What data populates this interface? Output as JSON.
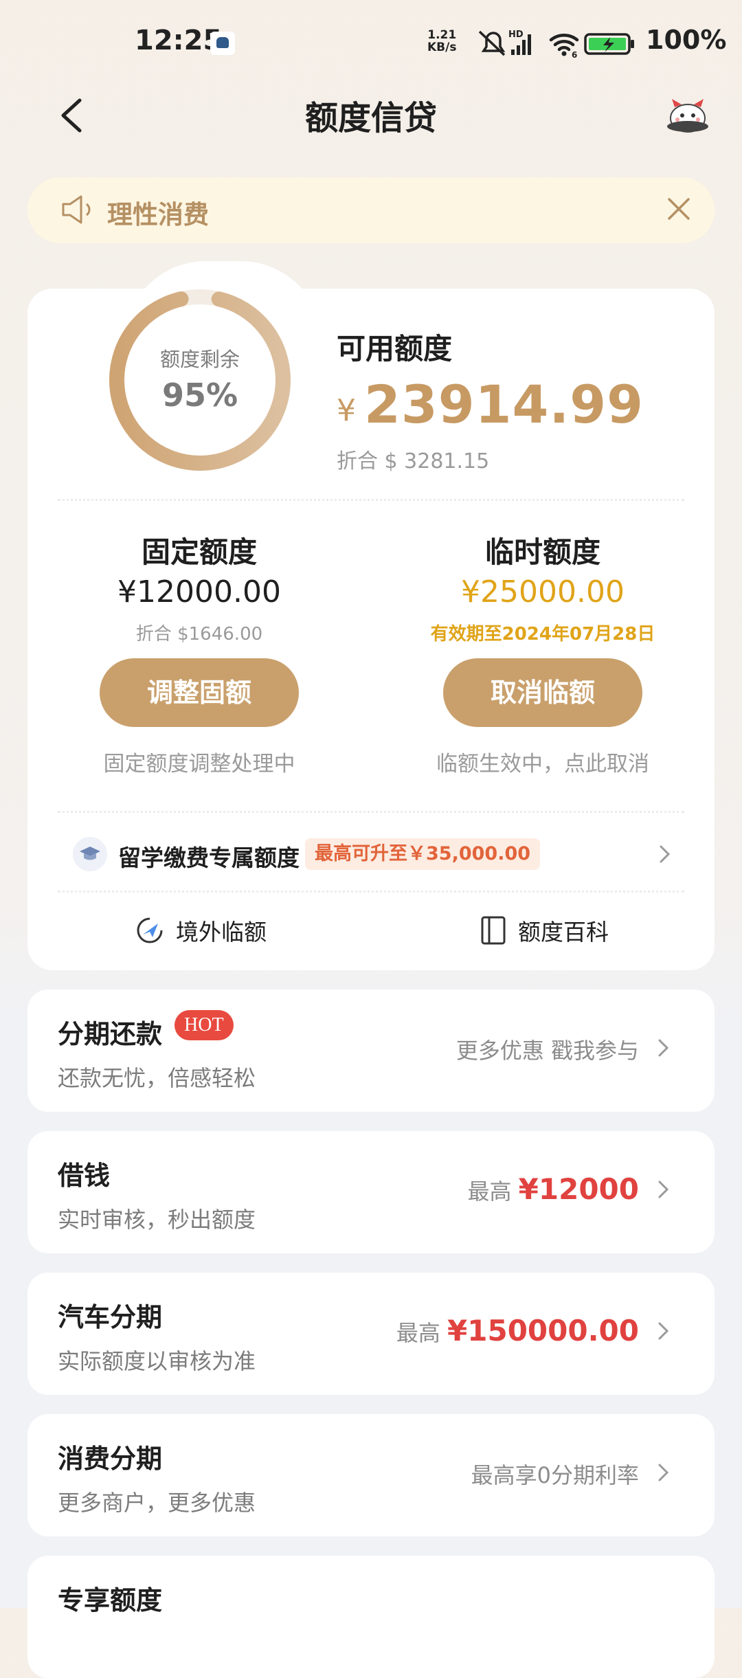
{
  "status_bar": {
    "time": "12:25",
    "net_speed_top": "1.21",
    "net_speed_bottom": "KB/s",
    "hd": "HD",
    "wifi_num": "6",
    "battery": "100%"
  },
  "nav": {
    "title": "额度信贷"
  },
  "notice": {
    "text": "理性消费"
  },
  "quota": {
    "ring_label": "额度剩余",
    "ring_value": "95%",
    "ring_fraction": 0.95,
    "available_label": "可用额度",
    "currency": "¥",
    "available_value": "23914.99",
    "converted": "折合 $ 3281.15"
  },
  "fixed": {
    "title": "固定额度",
    "amount": "¥12000.00",
    "converted": "折合 $1646.00",
    "button": "调整固额",
    "note": "固定额度调整处理中"
  },
  "temporary": {
    "title": "临时额度",
    "amount": "¥25000.00",
    "valid": "有效期至2024年07月28日",
    "button": "取消临额",
    "note": "临额生效中，点此取消"
  },
  "study": {
    "label": "留学缴费专属额度",
    "tag": "最高可升至￥35,000.00"
  },
  "links": {
    "overseas": "境外临额",
    "wiki": "额度百科"
  },
  "list": [
    {
      "title": "分期还款",
      "badge": "HOT",
      "subtitle": "还款无忧，倍感轻松",
      "right_text": "更多优惠 戳我参与",
      "right_amount": ""
    },
    {
      "title": "借钱",
      "badge": "",
      "subtitle": "实时审核，秒出额度",
      "right_text": "最高",
      "right_amount": "¥12000"
    },
    {
      "title": "汽车分期",
      "badge": "",
      "subtitle": "实际额度以审核为准",
      "right_text": "最高",
      "right_amount": "¥150000.00"
    },
    {
      "title": "消费分期",
      "badge": "",
      "subtitle": "更多商户，更多优惠",
      "right_text": "最高享0分期利率",
      "right_amount": ""
    },
    {
      "title": "专享额度",
      "badge": "",
      "subtitle": "",
      "right_text": "",
      "right_amount": ""
    }
  ],
  "colors": {
    "gold": "#c9a06c",
    "amount_gold": "#c79a63",
    "temp_yellow": "#e0a419",
    "red": "#e0423f",
    "notice_bg": "#fdf6e3"
  }
}
